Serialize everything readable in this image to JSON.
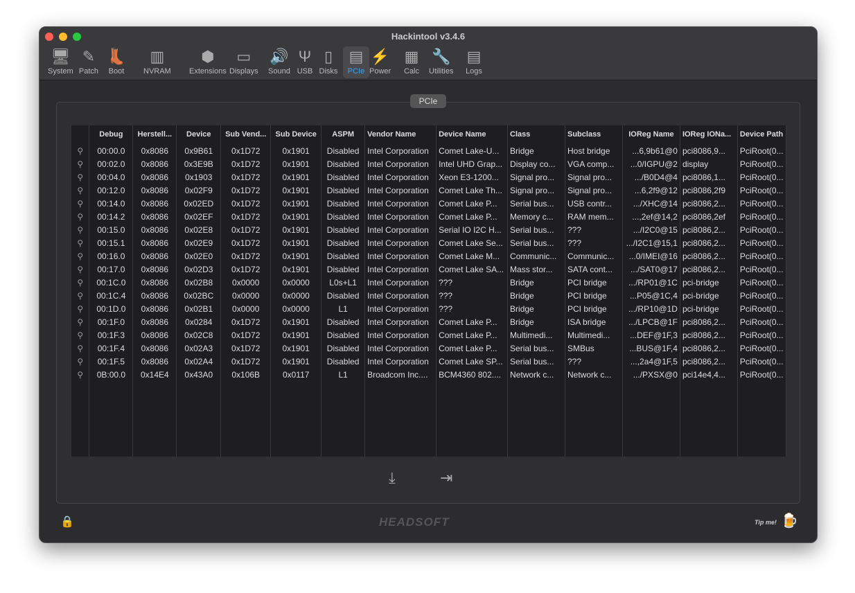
{
  "window": {
    "title": "Hackintool v3.4.6"
  },
  "toolbar": [
    {
      "label": "System",
      "icon": "computer-icon",
      "g": "🖥"
    },
    {
      "label": "Patch",
      "icon": "bandage-icon",
      "g": "✎"
    },
    {
      "label": "Boot",
      "icon": "boot-icon",
      "g": "👢"
    },
    {
      "label": "NVRAM",
      "icon": "memory-chip-icon",
      "g": "▥"
    },
    {
      "label": "Extensions",
      "icon": "lego-brick-icon",
      "g": "⬢"
    },
    {
      "label": "Displays",
      "icon": "monitor-icon",
      "g": "▭"
    },
    {
      "label": "Sound",
      "icon": "speaker-icon",
      "g": "🔊"
    },
    {
      "label": "USB",
      "icon": "usb-icon",
      "g": "Ψ"
    },
    {
      "label": "Disks",
      "icon": "disk-icon",
      "g": "▯"
    },
    {
      "label": "PCIe",
      "icon": "pcie-card-icon",
      "g": "▤"
    },
    {
      "label": "Power",
      "icon": "power-bolt-icon",
      "g": "⚡"
    },
    {
      "label": "Calc",
      "icon": "calculator-icon",
      "g": "▦"
    },
    {
      "label": "Utilities",
      "icon": "wrench-icon",
      "g": "🔧"
    },
    {
      "label": "Logs",
      "icon": "log-icon",
      "g": "▤"
    }
  ],
  "panel": {
    "tab": "PCIe"
  },
  "table": {
    "columns": [
      "",
      "Debug",
      "Herstell...",
      "Device",
      "Sub Vend...",
      "Sub Device",
      "ASPM",
      "Vendor Name",
      "Device Name",
      "Class",
      "Subclass",
      "IOReg Name",
      "IOReg IONa...",
      "Device Path"
    ],
    "rows": [
      [
        "00:00.0",
        "0x8086",
        "0x9B61",
        "0x1D72",
        "0x1901",
        "Disabled",
        "Intel Corporation",
        "Comet Lake-U...",
        "Bridge",
        "Host bridge",
        "...6,9b61@0",
        "pci8086,9...",
        "PciRoot(0..."
      ],
      [
        "00:02.0",
        "0x8086",
        "0x3E9B",
        "0x1D72",
        "0x1901",
        "Disabled",
        "Intel Corporation",
        "Intel UHD Grap...",
        "Display co...",
        "VGA comp...",
        "...0/IGPU@2",
        "display",
        "PciRoot(0..."
      ],
      [
        "00:04.0",
        "0x8086",
        "0x1903",
        "0x1D72",
        "0x1901",
        "Disabled",
        "Intel Corporation",
        "Xeon E3-1200...",
        "Signal pro...",
        "Signal pro...",
        ".../B0D4@4",
        "pci8086,1...",
        "PciRoot(0..."
      ],
      [
        "00:12.0",
        "0x8086",
        "0x02F9",
        "0x1D72",
        "0x1901",
        "Disabled",
        "Intel Corporation",
        "Comet Lake Th...",
        "Signal pro...",
        "Signal pro...",
        "...6,2f9@12",
        "pci8086,2f9",
        "PciRoot(0..."
      ],
      [
        "00:14.0",
        "0x8086",
        "0x02ED",
        "0x1D72",
        "0x1901",
        "Disabled",
        "Intel Corporation",
        "Comet Lake P...",
        "Serial bus...",
        "USB contr...",
        ".../XHC@14",
        "pci8086,2...",
        "PciRoot(0..."
      ],
      [
        "00:14.2",
        "0x8086",
        "0x02EF",
        "0x1D72",
        "0x1901",
        "Disabled",
        "Intel Corporation",
        "Comet Lake P...",
        "Memory c...",
        "RAM mem...",
        "...,2ef@14,2",
        "pci8086,2ef",
        "PciRoot(0..."
      ],
      [
        "00:15.0",
        "0x8086",
        "0x02E8",
        "0x1D72",
        "0x1901",
        "Disabled",
        "Intel Corporation",
        "Serial IO I2C H...",
        "Serial bus...",
        "???",
        ".../I2C0@15",
        "pci8086,2...",
        "PciRoot(0..."
      ],
      [
        "00:15.1",
        "0x8086",
        "0x02E9",
        "0x1D72",
        "0x1901",
        "Disabled",
        "Intel Corporation",
        "Comet Lake Se...",
        "Serial bus...",
        "???",
        ".../I2C1@15,1",
        "pci8086,2...",
        "PciRoot(0..."
      ],
      [
        "00:16.0",
        "0x8086",
        "0x02E0",
        "0x1D72",
        "0x1901",
        "Disabled",
        "Intel Corporation",
        "Comet Lake M...",
        "Communic...",
        "Communic...",
        "...0/IMEI@16",
        "pci8086,2...",
        "PciRoot(0..."
      ],
      [
        "00:17.0",
        "0x8086",
        "0x02D3",
        "0x1D72",
        "0x1901",
        "Disabled",
        "Intel Corporation",
        "Comet Lake SA...",
        "Mass stor...",
        "SATA cont...",
        ".../SAT0@17",
        "pci8086,2...",
        "PciRoot(0..."
      ],
      [
        "00:1C.0",
        "0x8086",
        "0x02B8",
        "0x0000",
        "0x0000",
        "L0s+L1",
        "Intel Corporation",
        "???",
        "Bridge",
        "PCI bridge",
        ".../RP01@1C",
        "pci-bridge",
        "PciRoot(0..."
      ],
      [
        "00:1C.4",
        "0x8086",
        "0x02BC",
        "0x0000",
        "0x0000",
        "Disabled",
        "Intel Corporation",
        "???",
        "Bridge",
        "PCI bridge",
        "...P05@1C,4",
        "pci-bridge",
        "PciRoot(0..."
      ],
      [
        "00:1D.0",
        "0x8086",
        "0x02B1",
        "0x0000",
        "0x0000",
        "L1",
        "Intel Corporation",
        "???",
        "Bridge",
        "PCI bridge",
        ".../RP10@1D",
        "pci-bridge",
        "PciRoot(0..."
      ],
      [
        "00:1F.0",
        "0x8086",
        "0x0284",
        "0x1D72",
        "0x1901",
        "Disabled",
        "Intel Corporation",
        "Comet Lake P...",
        "Bridge",
        "ISA bridge",
        ".../LPCB@1F",
        "pci8086,2...",
        "PciRoot(0..."
      ],
      [
        "00:1F.3",
        "0x8086",
        "0x02C8",
        "0x1D72",
        "0x1901",
        "Disabled",
        "Intel Corporation",
        "Comet Lake P...",
        "Multimedi...",
        "Multimedi...",
        "...DEF@1F,3",
        "pci8086,2...",
        "PciRoot(0..."
      ],
      [
        "00:1F.4",
        "0x8086",
        "0x02A3",
        "0x1D72",
        "0x1901",
        "Disabled",
        "Intel Corporation",
        "Comet Lake P...",
        "Serial bus...",
        "SMBus",
        "...BUS@1F,4",
        "pci8086,2...",
        "PciRoot(0..."
      ],
      [
        "00:1F.5",
        "0x8086",
        "0x02A4",
        "0x1D72",
        "0x1901",
        "Disabled",
        "Intel Corporation",
        "Comet Lake SP...",
        "Serial bus...",
        "???",
        "...,2a4@1F,5",
        "pci8086,2...",
        "PciRoot(0..."
      ],
      [
        "0B:00.0",
        "0x14E4",
        "0x43A0",
        "0x106B",
        "0x0117",
        "L1",
        "Broadcom Inc....",
        "BCM4360 802....",
        "Network c...",
        "Network c...",
        ".../PXSX@0",
        "pci14e4,4...",
        "PciRoot(0..."
      ]
    ]
  },
  "footer": {
    "logo": "HEADSOFT",
    "tip": "Tip me!"
  },
  "colors": {
    "accent": "#2ea8ff",
    "lock": "#f0a030"
  }
}
